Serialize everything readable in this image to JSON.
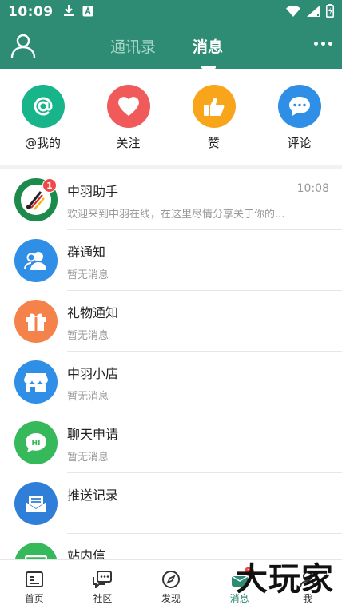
{
  "status_bar": {
    "time": "10:09"
  },
  "header": {
    "tabs": [
      {
        "label": "通讯录",
        "active": false
      },
      {
        "label": "消息",
        "active": true
      }
    ]
  },
  "quick_actions": [
    {
      "label": "@我的",
      "icon": "at-icon",
      "color": "#18b48a"
    },
    {
      "label": "关注",
      "icon": "heart-icon",
      "color": "#f05a5a"
    },
    {
      "label": "赞",
      "icon": "thumbs-up-icon",
      "color": "#f8a51c"
    },
    {
      "label": "评论",
      "icon": "comment-icon",
      "color": "#2f8ee6"
    }
  ],
  "messages": [
    {
      "title": "中羽助手",
      "subtitle": "欢迎来到中羽在线，在这里尽情分享关于你的...",
      "time": "10:08",
      "badge": "1",
      "icon": "badminton-logo-icon"
    },
    {
      "title": "群通知",
      "subtitle": "暂无消息",
      "icon": "group-icon",
      "color": "#2f8ee6"
    },
    {
      "title": "礼物通知",
      "subtitle": "暂无消息",
      "icon": "gift-icon",
      "color": "#f5824a"
    },
    {
      "title": "中羽小店",
      "subtitle": "暂无消息",
      "icon": "store-icon",
      "color": "#2f8ee6"
    },
    {
      "title": "聊天申请",
      "subtitle": "暂无消息",
      "icon": "chat-hi-icon",
      "color": "#35b95a"
    },
    {
      "title": "推送记录",
      "subtitle": "",
      "icon": "mail-tray-icon",
      "color": "#2f7fd8"
    },
    {
      "title": "站内信",
      "subtitle": "",
      "icon": "inbox-icon",
      "color": "#35b95a"
    }
  ],
  "bottom_nav": [
    {
      "label": "首页",
      "icon": "home-feed-icon",
      "active": false
    },
    {
      "label": "社区",
      "icon": "community-icon",
      "active": false
    },
    {
      "label": "发现",
      "icon": "compass-icon",
      "active": false
    },
    {
      "label": "消息",
      "icon": "message-icon",
      "active": true,
      "badge": "1"
    },
    {
      "label": "我",
      "icon": "user-icon",
      "active": false
    }
  ],
  "watermark": "大玩家",
  "colors": {
    "brand": "#2e8b74",
    "badge": "#f04848"
  }
}
